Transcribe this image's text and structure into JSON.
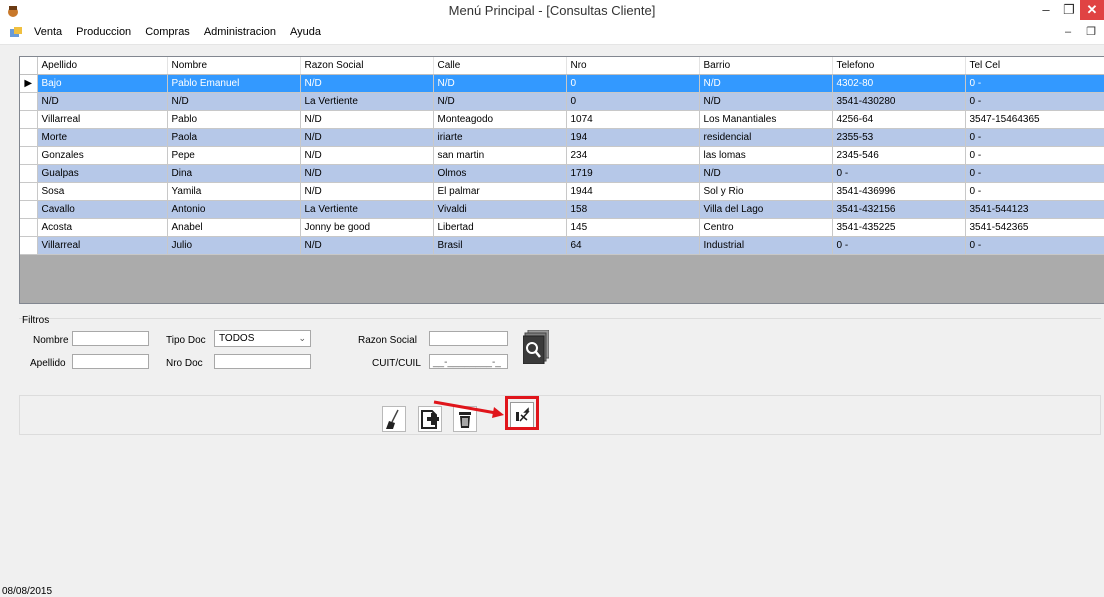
{
  "window": {
    "title": "Menú Principal - [Consultas Cliente]",
    "minimize": "–",
    "maximize": "❐",
    "close": "✕"
  },
  "menubar": {
    "items": [
      "Venta",
      "Produccion",
      "Compras",
      "Administracion",
      "Ayuda"
    ],
    "mdi_controls": "– ❐"
  },
  "grid": {
    "selected_row_marker": "▶",
    "columns": [
      "Apellido",
      "Nombre",
      "Razon Social",
      "Calle",
      "Nro",
      "Barrio",
      "Telefono",
      "Tel Cel"
    ],
    "rows": [
      [
        "Bajo",
        "Pablo Emanuel",
        "N/D",
        "N/D",
        "0",
        "N/D",
        "4302-80",
        "0 -"
      ],
      [
        "N/D",
        "N/D",
        "La Vertiente",
        "N/D",
        "0",
        "N/D",
        "3541-430280",
        "0 -"
      ],
      [
        "Villarreal",
        "Pablo",
        "N/D",
        "Monteagodo",
        "1074",
        "Los Manantiales",
        "4256-64",
        "3547-15464365"
      ],
      [
        "Morte",
        "Paola",
        "N/D",
        "iriarte",
        "194",
        "residencial",
        "2355-53",
        "0 -"
      ],
      [
        "Gonzales",
        "Pepe",
        "N/D",
        "san martin",
        "234",
        "las lomas",
        "2345-546",
        "0 -"
      ],
      [
        "Gualpas",
        "Dina",
        "N/D",
        "Olmos",
        "1719",
        "N/D",
        "0 -",
        "0 -"
      ],
      [
        "Sosa",
        "Yamila",
        "N/D",
        "El palmar",
        "1944",
        "Sol y Rio",
        "3541-436996",
        "0 -"
      ],
      [
        "Cavallo",
        "Antonio",
        "La Vertiente",
        "Vivaldi",
        "158",
        "Villa del Lago",
        "3541-432156",
        "3541-544123"
      ],
      [
        "Acosta",
        "Anabel",
        "Jonny be good",
        "Libertad",
        "145",
        "Centro",
        "3541-435225",
        "3541-542365"
      ],
      [
        "Villarreal",
        "Julio",
        "N/D",
        "Brasil",
        "64",
        "Industrial",
        "0 -",
        "0 -"
      ]
    ]
  },
  "filters": {
    "group_label": "Filtros",
    "nombre_label": "Nombre",
    "apellido_label": "Apellido",
    "tipo_doc_label": "Tipo Doc",
    "tipo_doc_value": "TODOS",
    "nro_doc_label": "Nro Doc",
    "razon_social_label": "Razon Social",
    "cuit_label": "CUIT/CUIL",
    "cuit_mask": "__-________-_"
  },
  "status": {
    "date": "08/08/2015"
  },
  "colors": {
    "selected_row": "#3399ff",
    "alt_row": "#b6c8e8",
    "highlight": "#e0151b",
    "close_button": "#e04343"
  },
  "icons": [
    "app-icon",
    "broom-icon",
    "add-document-icon",
    "trash-icon",
    "export-icon",
    "search-icon"
  ]
}
